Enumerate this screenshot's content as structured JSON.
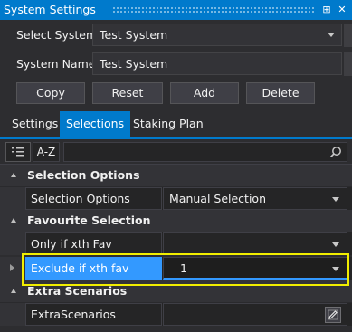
{
  "window": {
    "title": "System Settings",
    "pin_glyph": "⊞",
    "close_glyph": "✕"
  },
  "form": {
    "select_system_label": "Select System:",
    "select_system_value": "Test System",
    "system_name_label": "System Name:",
    "system_name_value": "Test System"
  },
  "buttons": {
    "copy": "Copy",
    "reset": "Reset",
    "add": "Add",
    "delete": "Delete"
  },
  "tabs": [
    {
      "label": "Settings",
      "active": false
    },
    {
      "label": "Selections",
      "active": true
    },
    {
      "label": "Staking Plan",
      "active": false
    }
  ],
  "toolbar": {
    "sort_alpha_label": "A-Z",
    "search_placeholder": ""
  },
  "grid": {
    "categories": [
      {
        "label": "Selection Options"
      },
      {
        "label": "Favourite Selection"
      },
      {
        "label": "Extra Scenarios"
      }
    ],
    "properties": [
      {
        "name": "Selection Options",
        "value": "Manual Selection"
      },
      {
        "name": "Only if xth Fav",
        "value": ""
      },
      {
        "name": "Exclude if xth fav",
        "value": "1"
      },
      {
        "name": "ExtraScenarios",
        "value": ""
      }
    ]
  },
  "colors": {
    "accent": "#007acc",
    "selected": "#3399ff",
    "highlight": "#f1ee00",
    "background": "#2d2d30"
  }
}
